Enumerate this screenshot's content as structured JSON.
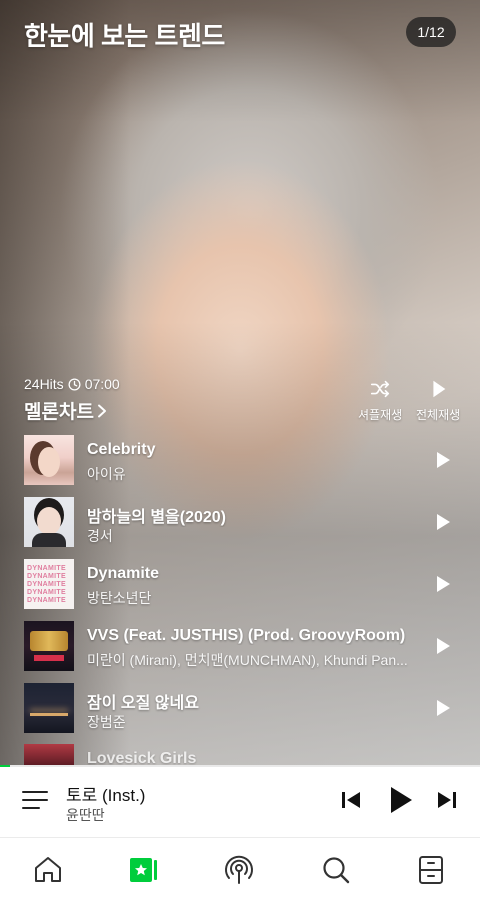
{
  "header": {
    "title": "한눈에 보는 트렌드",
    "page_indicator": "1/12"
  },
  "chart": {
    "meta_label": "24Hits",
    "time": "07:00",
    "title": "멜론차트",
    "shuffle_label": "셔플재생",
    "play_all_label": "전체재생",
    "songs": [
      {
        "title": "Celebrity",
        "artist": "아이유"
      },
      {
        "title": "밤하늘의 별을(2020)",
        "artist": "경서"
      },
      {
        "title": "Dynamite",
        "artist": "방탄소년단"
      },
      {
        "title": "VVS (Feat. JUSTHIS) (Prod. GroovyRoom)",
        "artist": "미란이 (Mirani), 먼치맨(MUNCHMAN), Khundi Pan..."
      },
      {
        "title": "잠이 오질 않네요",
        "artist": "장범준"
      },
      {
        "title": "Lovesick Girls",
        "artist": ""
      }
    ],
    "thumb3_lines": [
      "DYNAMITE",
      "DYNAMITE",
      "DYNAMITE",
      "DYNAMITE",
      "DYNAMITE"
    ]
  },
  "now_playing": {
    "title": "토로 (Inst.)",
    "artist": "윤딴딴",
    "progress": 0.02
  },
  "nav": {
    "items": [
      "home",
      "melon-chart",
      "radio",
      "search",
      "library"
    ],
    "active": "melon-chart"
  },
  "colors": {
    "accent": "#00cd3c",
    "text": "#111111",
    "muted": "#555555"
  },
  "icons": [
    "shuffle-icon",
    "play-icon",
    "clock-icon",
    "chevron-right-icon",
    "playlist-icon",
    "previous-icon",
    "next-icon",
    "home-icon",
    "chart-icon",
    "radio-icon",
    "search-icon",
    "library-icon"
  ]
}
